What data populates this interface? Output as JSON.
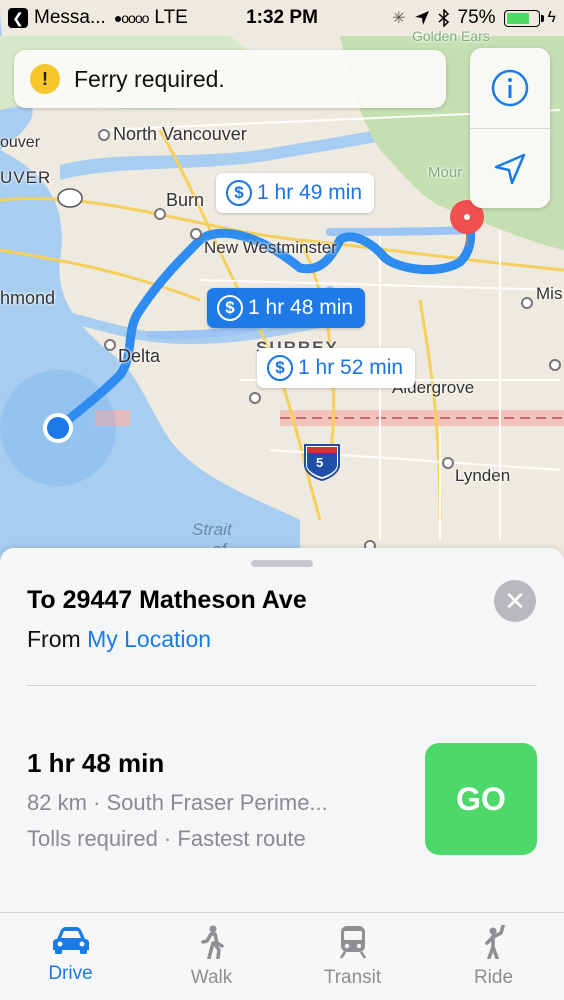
{
  "status_bar": {
    "carrier": "Messa...",
    "signal": "●oooo",
    "network": "LTE",
    "time": "1:32 PM",
    "battery": "75%",
    "battery_level": 0.75,
    "icons": [
      "back-arrow-icon",
      "activity-spinner-icon",
      "location-arrow-icon",
      "bluetooth-icon",
      "battery-icon",
      "charging-bolt-icon"
    ]
  },
  "banner": {
    "text": "Ferry required.",
    "icon": "warning-icon",
    "color": "#f7c52c"
  },
  "map_controls": {
    "info_icon": "info-icon",
    "location_icon": "location-arrow-icon"
  },
  "map": {
    "labels": {
      "north_vancouver": "North Vancouver",
      "uver": "UVER",
      "ouver": "ouver",
      "burn": "Burn",
      "new_westminster": "New Westminster",
      "hmond": "hmond",
      "delta": "Delta",
      "surrey": "SURREY",
      "aldergrove": "Aldergrove",
      "lynden": "Lynden",
      "strait": "Strait",
      "of": "of",
      "mis": "Mis",
      "golden_ears": "Golden Ears",
      "mount": "Mour",
      "highway": "5"
    },
    "routes": [
      {
        "label": "1 hr 49 min",
        "selected": false
      },
      {
        "label": "1 hr 48 min",
        "selected": true
      },
      {
        "label": "1 hr 52 min",
        "selected": false
      }
    ],
    "route_color": "#2e8bf0"
  },
  "sheet": {
    "destination": "To 29447 Matheson Ave",
    "from_prefix": "From",
    "from_link": "My Location",
    "route_time": "1 hr 48 min",
    "route_detail": "82 km · South Fraser Perime...",
    "route_note": "Tolls required · Fastest route",
    "go_label": "GO",
    "go_color": "#4cd96a"
  },
  "tabs": [
    {
      "label": "Drive",
      "icon": "car-icon",
      "active": true
    },
    {
      "label": "Walk",
      "icon": "walking-person-icon",
      "active": false
    },
    {
      "label": "Transit",
      "icon": "train-icon",
      "active": false
    },
    {
      "label": "Ride",
      "icon": "hailing-person-icon",
      "active": false
    }
  ],
  "accent_color": "#1a7ae8"
}
